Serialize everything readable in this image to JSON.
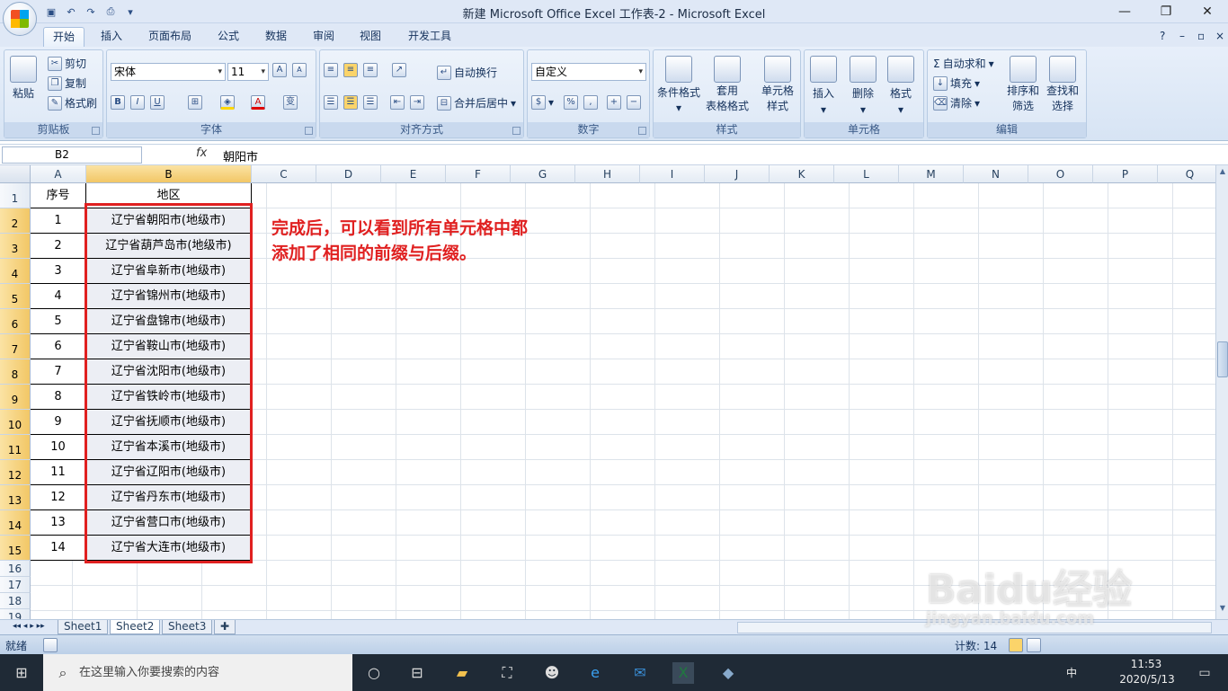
{
  "window": {
    "title": "新建 Microsoft Office Excel 工作表-2 - Microsoft Excel"
  },
  "ribbon": {
    "tabs": [
      "开始",
      "插入",
      "页面布局",
      "公式",
      "数据",
      "审阅",
      "视图",
      "开发工具"
    ],
    "active_tab": "开始",
    "clipboard": {
      "label": "剪贴板",
      "paste": "粘贴",
      "cut": "剪切",
      "copy": "复制",
      "format_painter": "格式刷"
    },
    "font": {
      "label": "字体",
      "name": "宋体",
      "size": "11",
      "bold": "B",
      "italic": "I",
      "underline": "U",
      "grow": "A",
      "shrink": "A",
      "color_letter": "A",
      "wen": "变"
    },
    "alignment": {
      "label": "对齐方式",
      "wrap": "自动换行",
      "merge": "合并后居中"
    },
    "number": {
      "label": "数字",
      "format": "自定义",
      "percent": "%",
      "comma": ","
    },
    "styles": {
      "label": "样式",
      "conditional": "条件格式",
      "table_fmt_1": "套用",
      "table_fmt_2": "表格格式",
      "cell_style_1": "单元格",
      "cell_style_2": "样式"
    },
    "cells": {
      "label": "单元格",
      "insert": "插入",
      "delete": "删除",
      "format": "格式"
    },
    "editing": {
      "label": "编辑",
      "autosum": "自动求和",
      "fill": "填充",
      "clear": "清除",
      "sort_1": "排序和",
      "sort_2": "筛选",
      "find_1": "查找和",
      "find_2": "选择"
    }
  },
  "formula_bar": {
    "name_box": "B2",
    "fx": "fx",
    "value": "朝阳市"
  },
  "columns": [
    "A",
    "B",
    "C",
    "D",
    "E",
    "F",
    "G",
    "H",
    "I",
    "J",
    "K",
    "L",
    "M",
    "N",
    "O",
    "P",
    "Q"
  ],
  "rows": [
    "1",
    "2",
    "3",
    "4",
    "5",
    "6",
    "7",
    "8",
    "9",
    "10",
    "11",
    "12",
    "13",
    "14",
    "15",
    "16",
    "17",
    "18",
    "19"
  ],
  "table": {
    "header": {
      "a": "序号",
      "b": "地区"
    },
    "rows": [
      {
        "a": "1",
        "b": "辽宁省朝阳市(地级市)"
      },
      {
        "a": "2",
        "b": "辽宁省葫芦岛市(地级市)"
      },
      {
        "a": "3",
        "b": "辽宁省阜新市(地级市)"
      },
      {
        "a": "4",
        "b": "辽宁省锦州市(地级市)"
      },
      {
        "a": "5",
        "b": "辽宁省盘锦市(地级市)"
      },
      {
        "a": "6",
        "b": "辽宁省鞍山市(地级市)"
      },
      {
        "a": "7",
        "b": "辽宁省沈阳市(地级市)"
      },
      {
        "a": "8",
        "b": "辽宁省铁岭市(地级市)"
      },
      {
        "a": "9",
        "b": "辽宁省抚顺市(地级市)"
      },
      {
        "a": "10",
        "b": "辽宁省本溪市(地级市)"
      },
      {
        "a": "11",
        "b": "辽宁省辽阳市(地级市)"
      },
      {
        "a": "12",
        "b": "辽宁省丹东市(地级市)"
      },
      {
        "a": "13",
        "b": "辽宁省营口市(地级市)"
      },
      {
        "a": "14",
        "b": "辽宁省大连市(地级市)"
      }
    ]
  },
  "annotation": {
    "line1": "完成后，可以看到所有单元格中都",
    "line2": "添加了相同的前缀与后缀。"
  },
  "sheets": [
    "Sheet1",
    "Sheet2",
    "Sheet3"
  ],
  "active_sheet": "Sheet2",
  "status": {
    "ready": "就绪",
    "count": "计数: 14"
  },
  "taskbar": {
    "search_placeholder": "在这里输入你要搜索的内容",
    "time": "11:53",
    "date": "2020/5/13",
    "ime": "中"
  },
  "watermark": {
    "text": "Baidu经验",
    "url": "jingyan.baidu.com"
  },
  "colors": {
    "accent_red": "#e02020",
    "selection": "#f2c766",
    "ribbon": "#dfe8f6"
  }
}
